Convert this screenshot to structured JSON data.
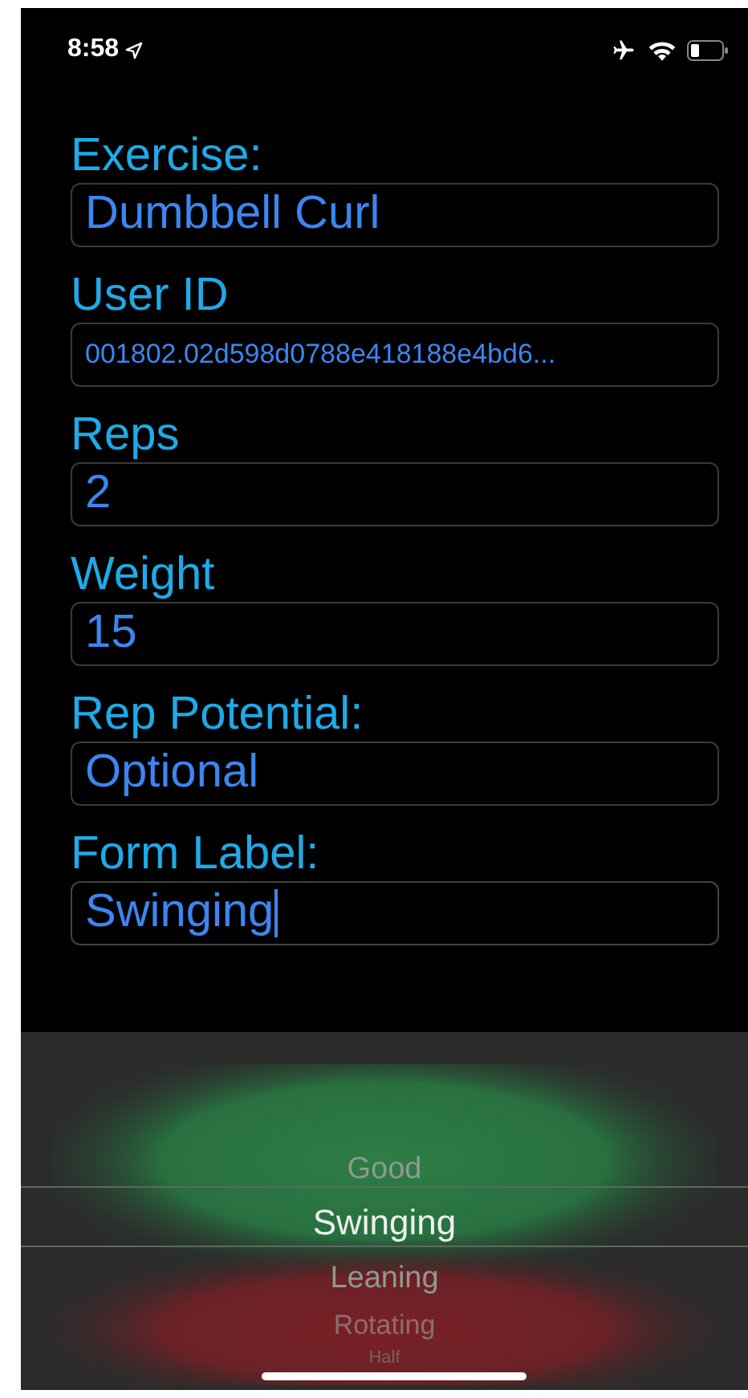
{
  "status_bar": {
    "time": "8:58"
  },
  "fields": [
    {
      "label": "Exercise:",
      "value": "Dumbbell Curl",
      "kind": "large",
      "focused": false
    },
    {
      "label": "User ID",
      "value": "001802.02d598d0788e418188e4bd6...",
      "kind": "small",
      "focused": false
    },
    {
      "label": "Reps",
      "value": "2",
      "kind": "large",
      "focused": false
    },
    {
      "label": "Weight",
      "value": "15",
      "kind": "large",
      "focused": false
    },
    {
      "label": "Rep Potential:",
      "value": "Optional",
      "kind": "large",
      "focused": false
    },
    {
      "label": "Form Label:",
      "value": "Swinging",
      "kind": "large",
      "focused": true
    }
  ],
  "picker": {
    "items": [
      {
        "label": "Good",
        "selected": false
      },
      {
        "label": "Swinging",
        "selected": true
      },
      {
        "label": "Leaning",
        "selected": false
      },
      {
        "label": "Rotating",
        "selected": false
      },
      {
        "label": "Half",
        "selected": false
      }
    ]
  }
}
